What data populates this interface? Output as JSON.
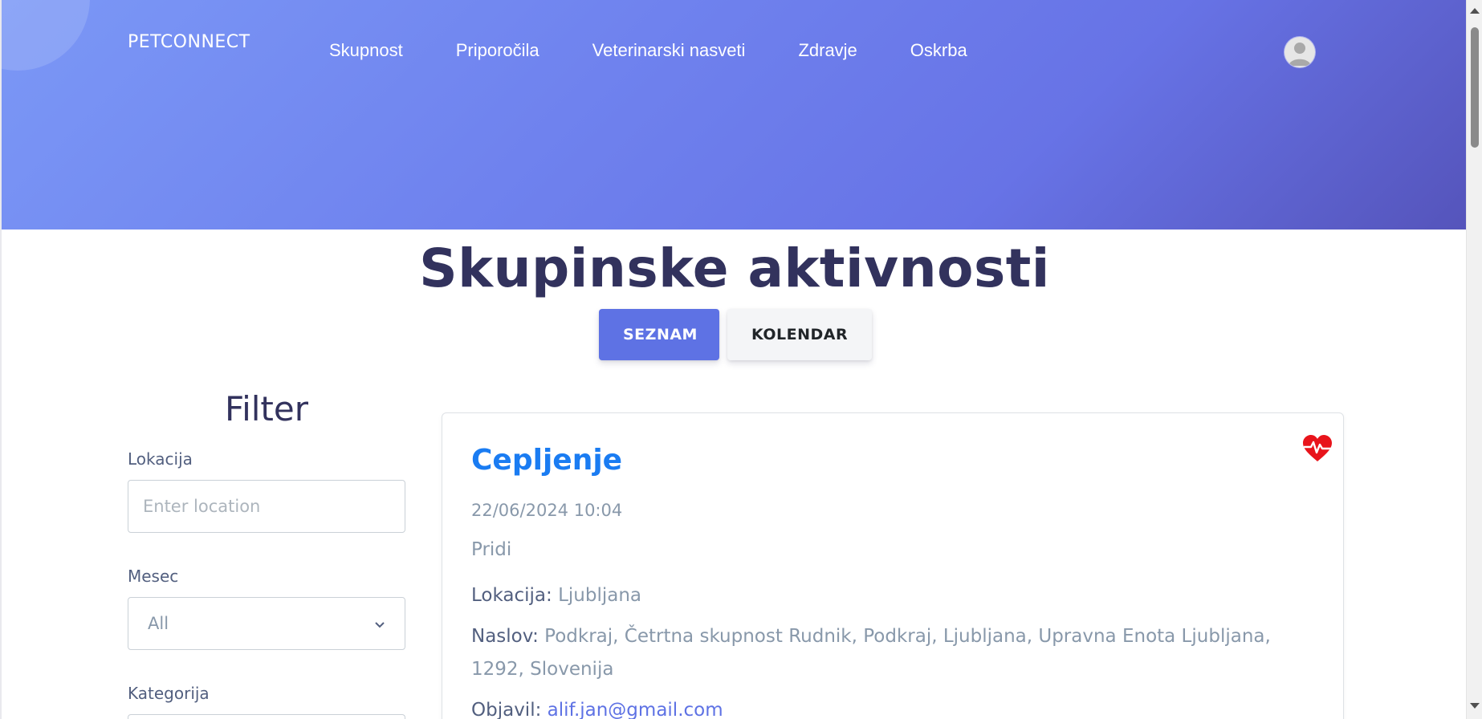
{
  "header": {
    "brand": "PETCONNECT",
    "nav": [
      "Skupnost",
      "Priporočila",
      "Veterinarski nasveti",
      "Zdravje",
      "Oskrba"
    ],
    "avatar_icon": "user-avatar-icon",
    "gradient_colors": [
      "#7b98f6",
      "#5554bb"
    ]
  },
  "page": {
    "title": "Skupinske aktivnosti",
    "view_buttons": {
      "list": "SEZNAM",
      "calendar": "KOLENDAR"
    }
  },
  "filter": {
    "title": "Filter",
    "location_label": "Lokacija",
    "location_placeholder": "Enter location",
    "month_label": "Mesec",
    "month_value": "All",
    "category_label": "Kategorija"
  },
  "activities": [
    {
      "title": "Cepljenje",
      "datetime": "22/06/2024 10:04",
      "description": "Pridi",
      "location_label": "Lokacija:",
      "location": "Ljubljana",
      "address_label": "Naslov:",
      "address": "Podkraj, Četrtna skupnost Rudnik, Podkraj, Ljubljana, Upravna Enota Ljubljana, 1292, Slovenija",
      "author_label": "Objavil:",
      "author": "alif.jan@gmail.com",
      "category_icon": "heartbeat-icon",
      "category_color": "#e8141b"
    }
  ],
  "colors": {
    "primary": "#5e72e4",
    "title_link": "#1a7cf2",
    "text_dark": "#32325d"
  }
}
